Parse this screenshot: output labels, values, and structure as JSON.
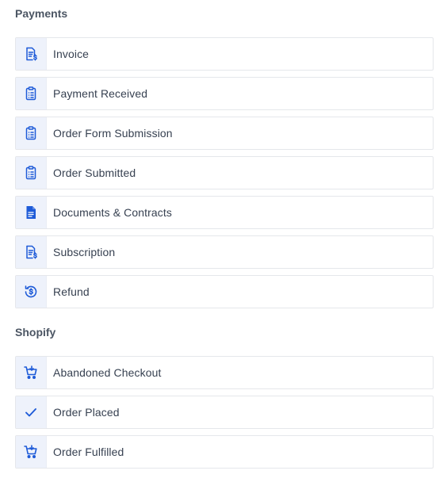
{
  "sections": [
    {
      "title": "Payments",
      "items": [
        {
          "label": "Invoice",
          "icon": "invoice-icon"
        },
        {
          "label": "Payment Received",
          "icon": "clipboard-list-icon"
        },
        {
          "label": "Order Form Submission",
          "icon": "clipboard-list-icon"
        },
        {
          "label": "Order Submitted",
          "icon": "clipboard-list-icon"
        },
        {
          "label": "Documents & Contracts",
          "icon": "document-icon"
        },
        {
          "label": "Subscription",
          "icon": "invoice-icon"
        },
        {
          "label": "Refund",
          "icon": "refund-icon"
        }
      ]
    },
    {
      "title": "Shopify",
      "items": [
        {
          "label": "Abandoned Checkout",
          "icon": "cart-icon"
        },
        {
          "label": "Order Placed",
          "icon": "check-icon"
        },
        {
          "label": "Order Fulfilled",
          "icon": "cart-icon"
        }
      ]
    }
  ],
  "colors": {
    "icon_accent": "#1e5bd8",
    "icon_background": "#eef2fb",
    "border": "#e5e7eb"
  }
}
